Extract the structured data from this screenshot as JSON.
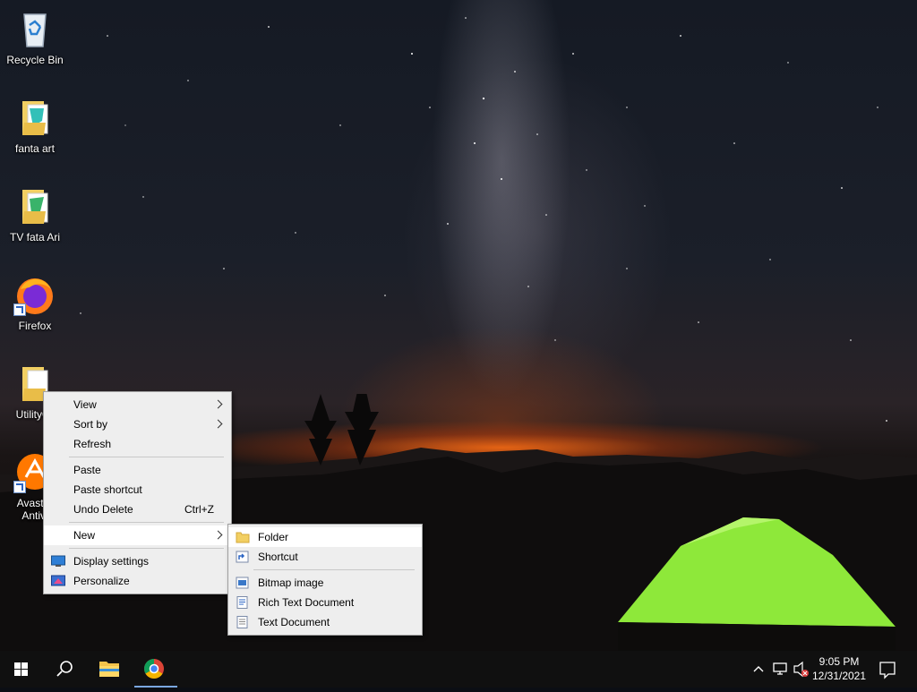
{
  "desktop": {
    "icons": [
      {
        "label": "Recycle Bin",
        "icon": "recycle-bin-icon"
      },
      {
        "label": "fanta art",
        "icon": "folder-icon"
      },
      {
        "label": "TV  fata Ari",
        "icon": "folder-icon"
      },
      {
        "label": "Firefox",
        "icon": "firefox-icon"
      },
      {
        "label": "UtilityOr",
        "icon": "folder-icon"
      },
      {
        "label_line1": "Avast F",
        "label_line2": "Antivi",
        "icon": "avast-icon"
      }
    ]
  },
  "context_menu": {
    "items": [
      {
        "label": "View",
        "submenu": true
      },
      {
        "label": "Sort by",
        "submenu": true
      },
      {
        "label": "Refresh"
      },
      {
        "label": "Paste"
      },
      {
        "label": "Paste shortcut"
      },
      {
        "label": "Undo Delete",
        "shortcut": "Ctrl+Z"
      },
      {
        "label": "New",
        "submenu": true,
        "highlighted": true
      },
      {
        "label": "Display settings",
        "icon": "display-icon"
      },
      {
        "label": "Personalize",
        "icon": "personalize-icon"
      }
    ]
  },
  "new_submenu": {
    "items": [
      {
        "label": "Folder",
        "icon": "folder-icon",
        "highlighted": true
      },
      {
        "label": "Shortcut",
        "icon": "shortcut-icon"
      },
      {
        "label": "Bitmap image",
        "icon": "bitmap-icon"
      },
      {
        "label": "Rich Text Document",
        "icon": "rich-text-icon"
      },
      {
        "label": "Text Document",
        "icon": "text-document-icon"
      }
    ]
  },
  "taskbar": {
    "buttons": [
      "windows-start-icon",
      "search-icon",
      "file-explorer-icon",
      "chrome-icon"
    ],
    "tray": [
      "chevron-up-icon",
      "network-icon",
      "volume-muted-icon",
      "notifications-icon"
    ],
    "time": "9:05 PM",
    "date": "12/31/2021"
  },
  "colors": {
    "menu_bg": "#eeeeee",
    "menu_highlight": "#ffffff",
    "taskbar_bg": "#101010",
    "folder": "#f2cf62",
    "tent": "#8ee83a"
  }
}
